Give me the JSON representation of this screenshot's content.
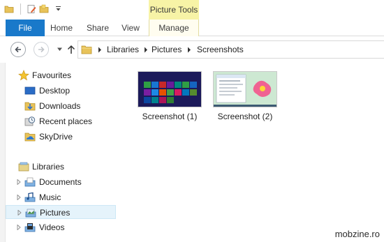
{
  "window": {
    "contextual_tab_group": "Picture Tools"
  },
  "ribbon": {
    "tabs": [
      {
        "label": "File"
      },
      {
        "label": "Home"
      },
      {
        "label": "Share"
      },
      {
        "label": "View"
      },
      {
        "label": "Manage"
      }
    ]
  },
  "address": {
    "segments": [
      "Libraries",
      "Pictures",
      "Screenshots"
    ]
  },
  "navigation": {
    "favourites_header": "Favourites",
    "favourites": [
      {
        "label": "Desktop",
        "icon": "desktop-icon"
      },
      {
        "label": "Downloads",
        "icon": "downloads-icon"
      },
      {
        "label": "Recent places",
        "icon": "recent-places-icon"
      },
      {
        "label": "SkyDrive",
        "icon": "skydrive-icon"
      }
    ],
    "libraries_header": "Libraries",
    "libraries": [
      {
        "label": "Documents",
        "icon": "documents-library-icon"
      },
      {
        "label": "Music",
        "icon": "music-library-icon"
      },
      {
        "label": "Pictures",
        "icon": "pictures-library-icon",
        "selected": true
      },
      {
        "label": "Videos",
        "icon": "videos-library-icon"
      }
    ]
  },
  "files": [
    {
      "name": "Screenshot (1)",
      "thumbnail": "start-screen"
    },
    {
      "name": "Screenshot (2)",
      "thumbnail": "desktop"
    }
  ],
  "watermark": "mobzine.ro",
  "colors": {
    "file_tab": "#1979ca",
    "contextual": "#f7f3a6",
    "selection": "#e5f3fb"
  }
}
